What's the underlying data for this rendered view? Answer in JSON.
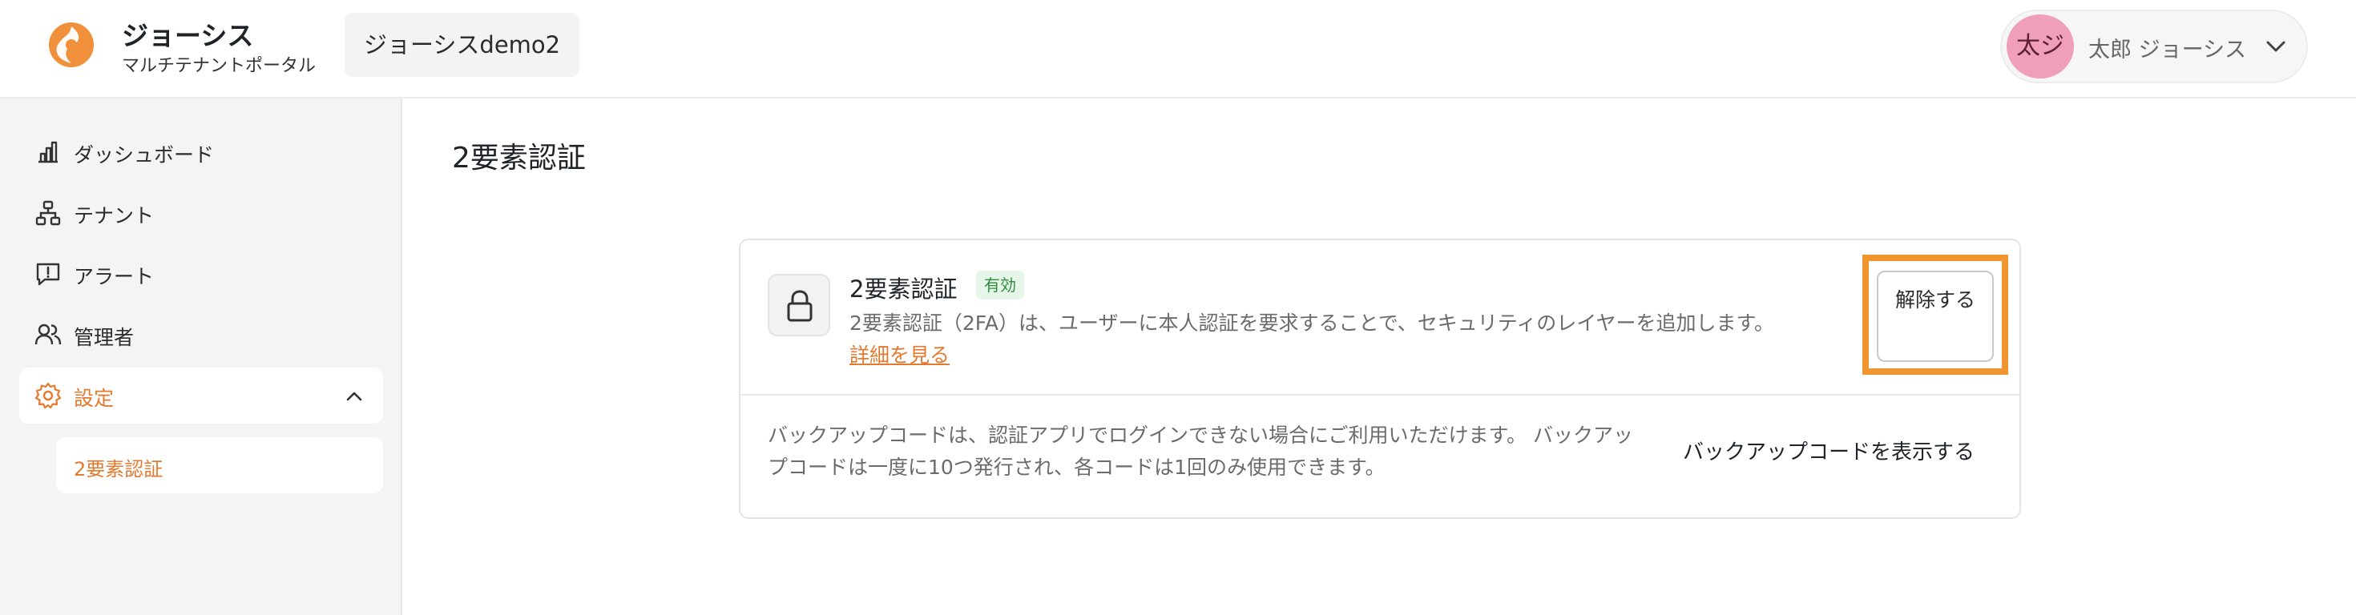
{
  "brand": {
    "name": "ジョーシス",
    "subtitle": "マルチテナントポータル",
    "accent": "#e37a2f"
  },
  "tenant": {
    "label": "ジョーシスdemo2"
  },
  "user": {
    "avatar_text": "太ジ",
    "name": "太郎 ジョーシス"
  },
  "sidebar": {
    "items": [
      {
        "label": "ダッシュボード",
        "icon": "bar-chart-icon"
      },
      {
        "label": "テナント",
        "icon": "hierarchy-icon"
      },
      {
        "label": "アラート",
        "icon": "alert-message-icon"
      },
      {
        "label": "管理者",
        "icon": "users-icon"
      },
      {
        "label": "設定",
        "icon": "gear-icon",
        "expanded": true
      }
    ],
    "sub_items": [
      {
        "label": "2要素認証"
      }
    ]
  },
  "main": {
    "title": "2要素認証",
    "two_factor": {
      "title": "2要素認証",
      "status_badge": "有効",
      "description": "2要素認証（2FA）は、ユーザーに本人認証を要求することで、セキュリティのレイヤーを追加します。",
      "more_link": "詳細を見る",
      "disable_button": "解除する"
    },
    "backup": {
      "description": "バックアップコードは、認証アプリでログインできない場合にご利用いただけます。 バックアップコードは一度に10つ発行され、各コードは1回のみ使用できます。",
      "show_button": "バックアップコードを表示する"
    }
  }
}
